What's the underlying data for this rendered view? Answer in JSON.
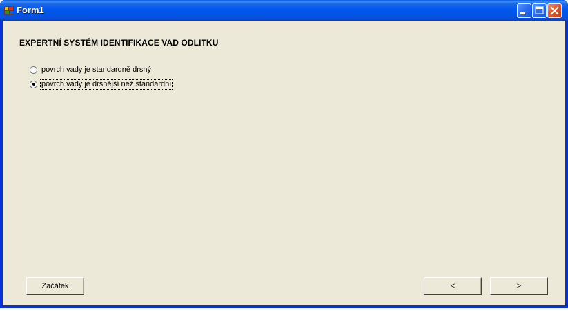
{
  "window": {
    "title": "Form1",
    "icon": "app-form-icon",
    "controls": {
      "minimize_icon": "minimize-icon",
      "maximize_icon": "maximize-icon",
      "close_icon": "close-icon"
    },
    "colors": {
      "titlebar": "#0058ee",
      "client_background": "#ece9d8",
      "close_button": "#d9582a"
    }
  },
  "form": {
    "heading": "EXPERTNÍ SYSTÉM IDENTIFIKACE VAD ODLITKU",
    "options": [
      {
        "label": "povrch vady je standardně drsný",
        "selected": false
      },
      {
        "label": "povrch vady je drsnější než standardní",
        "selected": true
      }
    ]
  },
  "buttons": {
    "start_label": "Začátek",
    "prev_label": "<",
    "next_label": ">"
  }
}
